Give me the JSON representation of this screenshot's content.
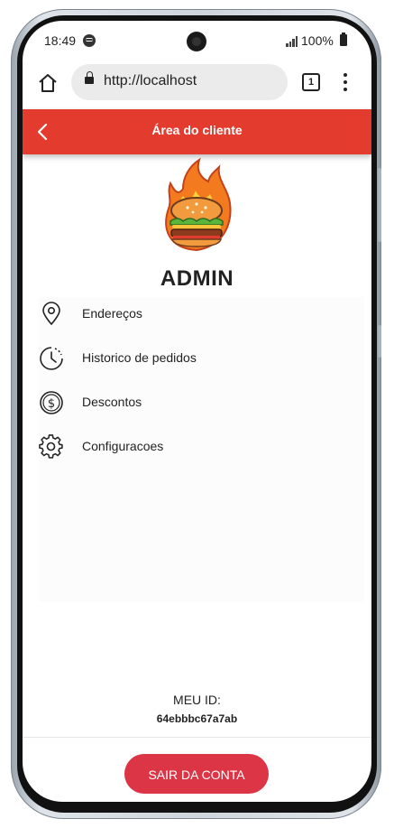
{
  "status_bar": {
    "time": "18:49",
    "battery": "100%"
  },
  "browser": {
    "url": "http://localhost",
    "tab_count": "1"
  },
  "header": {
    "title": "Área do cliente"
  },
  "profile": {
    "username": "ADMIN"
  },
  "menu": {
    "items": [
      {
        "label": "Endereços",
        "icon": "location-pin-icon"
      },
      {
        "label": "Historico de pedidos",
        "icon": "clock-history-icon"
      },
      {
        "label": "Descontos",
        "icon": "dollar-coin-icon"
      },
      {
        "label": "Configuracoes",
        "icon": "gear-icon"
      }
    ]
  },
  "account": {
    "id_label": "MEU ID:",
    "id_value": "64ebbbc67a7ab"
  },
  "actions": {
    "logout_label": "SAIR DA CONTA"
  },
  "colors": {
    "accent": "#e43b2f",
    "logout": "#dc3545"
  }
}
